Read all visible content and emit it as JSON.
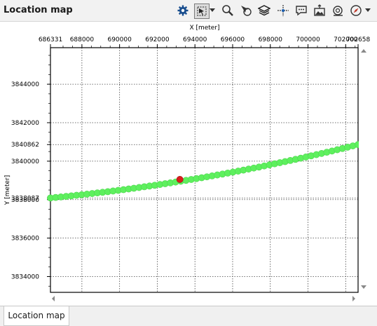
{
  "window": {
    "title": "Location map"
  },
  "toolbar": {
    "icons": [
      "gear-icon",
      "select-region-icon",
      "dropdown-arrow-icon",
      "zoom-icon",
      "pick-pointer-icon",
      "layers-icon",
      "crosshair-icon",
      "annotation-icon",
      "export-image-icon",
      "survey-icon",
      "compass-icon",
      "dropdown-arrow-icon"
    ]
  },
  "chart_data": {
    "type": "scatter",
    "xlabel": "X [meter]",
    "ylabel": "Y [meter]",
    "xlim": [
      686331,
      702658
    ],
    "ylim": [
      3833180,
      3845900
    ],
    "x_ticks": [
      "686331",
      "688000",
      "690000",
      "692000",
      "694000",
      "696000",
      "698000",
      "700000",
      "702000",
      "702658"
    ],
    "x_tick_values": [
      686331,
      688000,
      690000,
      692000,
      694000,
      696000,
      698000,
      700000,
      702000,
      702658
    ],
    "y_ticks": [
      "3844000",
      "3842000",
      "3840862",
      "3840000",
      "3838087",
      "3838000",
      "3836000",
      "3834000"
    ],
    "y_tick_values": [
      3844000,
      3842000,
      3840862,
      3840000,
      3838087,
      3838000,
      3836000,
      3834000
    ],
    "grid": true,
    "series": [
      {
        "color": "#5ef05e",
        "x": [
          686331,
          702658
        ],
        "y": [
          3838087,
          3840862
        ],
        "points": 60
      }
    ],
    "highlight": {
      "x": 693200,
      "y": 3839050,
      "color": "#d81e1e"
    }
  },
  "tabs": [
    {
      "label": "Location map"
    }
  ]
}
